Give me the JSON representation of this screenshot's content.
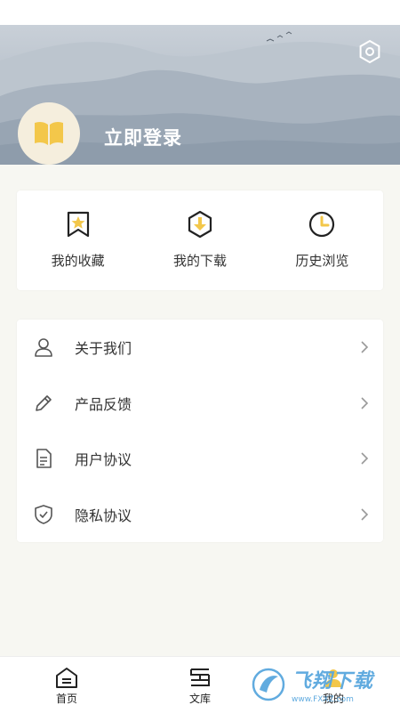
{
  "header": {
    "login_text": "立即登录"
  },
  "icons": {
    "settings": "settings-hex-icon",
    "avatar": "book-icon"
  },
  "quick_actions": [
    {
      "label": "我的收藏",
      "icon": "bookmark-star-icon"
    },
    {
      "label": "我的下载",
      "icon": "download-icon"
    },
    {
      "label": "历史浏览",
      "icon": "clock-icon"
    }
  ],
  "menu": [
    {
      "label": "关于我们",
      "icon": "user-icon"
    },
    {
      "label": "产品反馈",
      "icon": "pencil-icon"
    },
    {
      "label": "用户协议",
      "icon": "document-icon"
    },
    {
      "label": "隐私协议",
      "icon": "shield-check-icon"
    }
  ],
  "tabs": [
    {
      "label": "首页",
      "icon": "home-icon"
    },
    {
      "label": "文库",
      "icon": "library-icon"
    },
    {
      "label": "我的",
      "icon": "profile-icon"
    }
  ],
  "watermark": {
    "text": "飞翔下载",
    "sub": "www.FXXZ.com"
  },
  "colors": {
    "accent": "#f3c74a",
    "background": "#f7f7f2",
    "card": "#ffffff"
  }
}
